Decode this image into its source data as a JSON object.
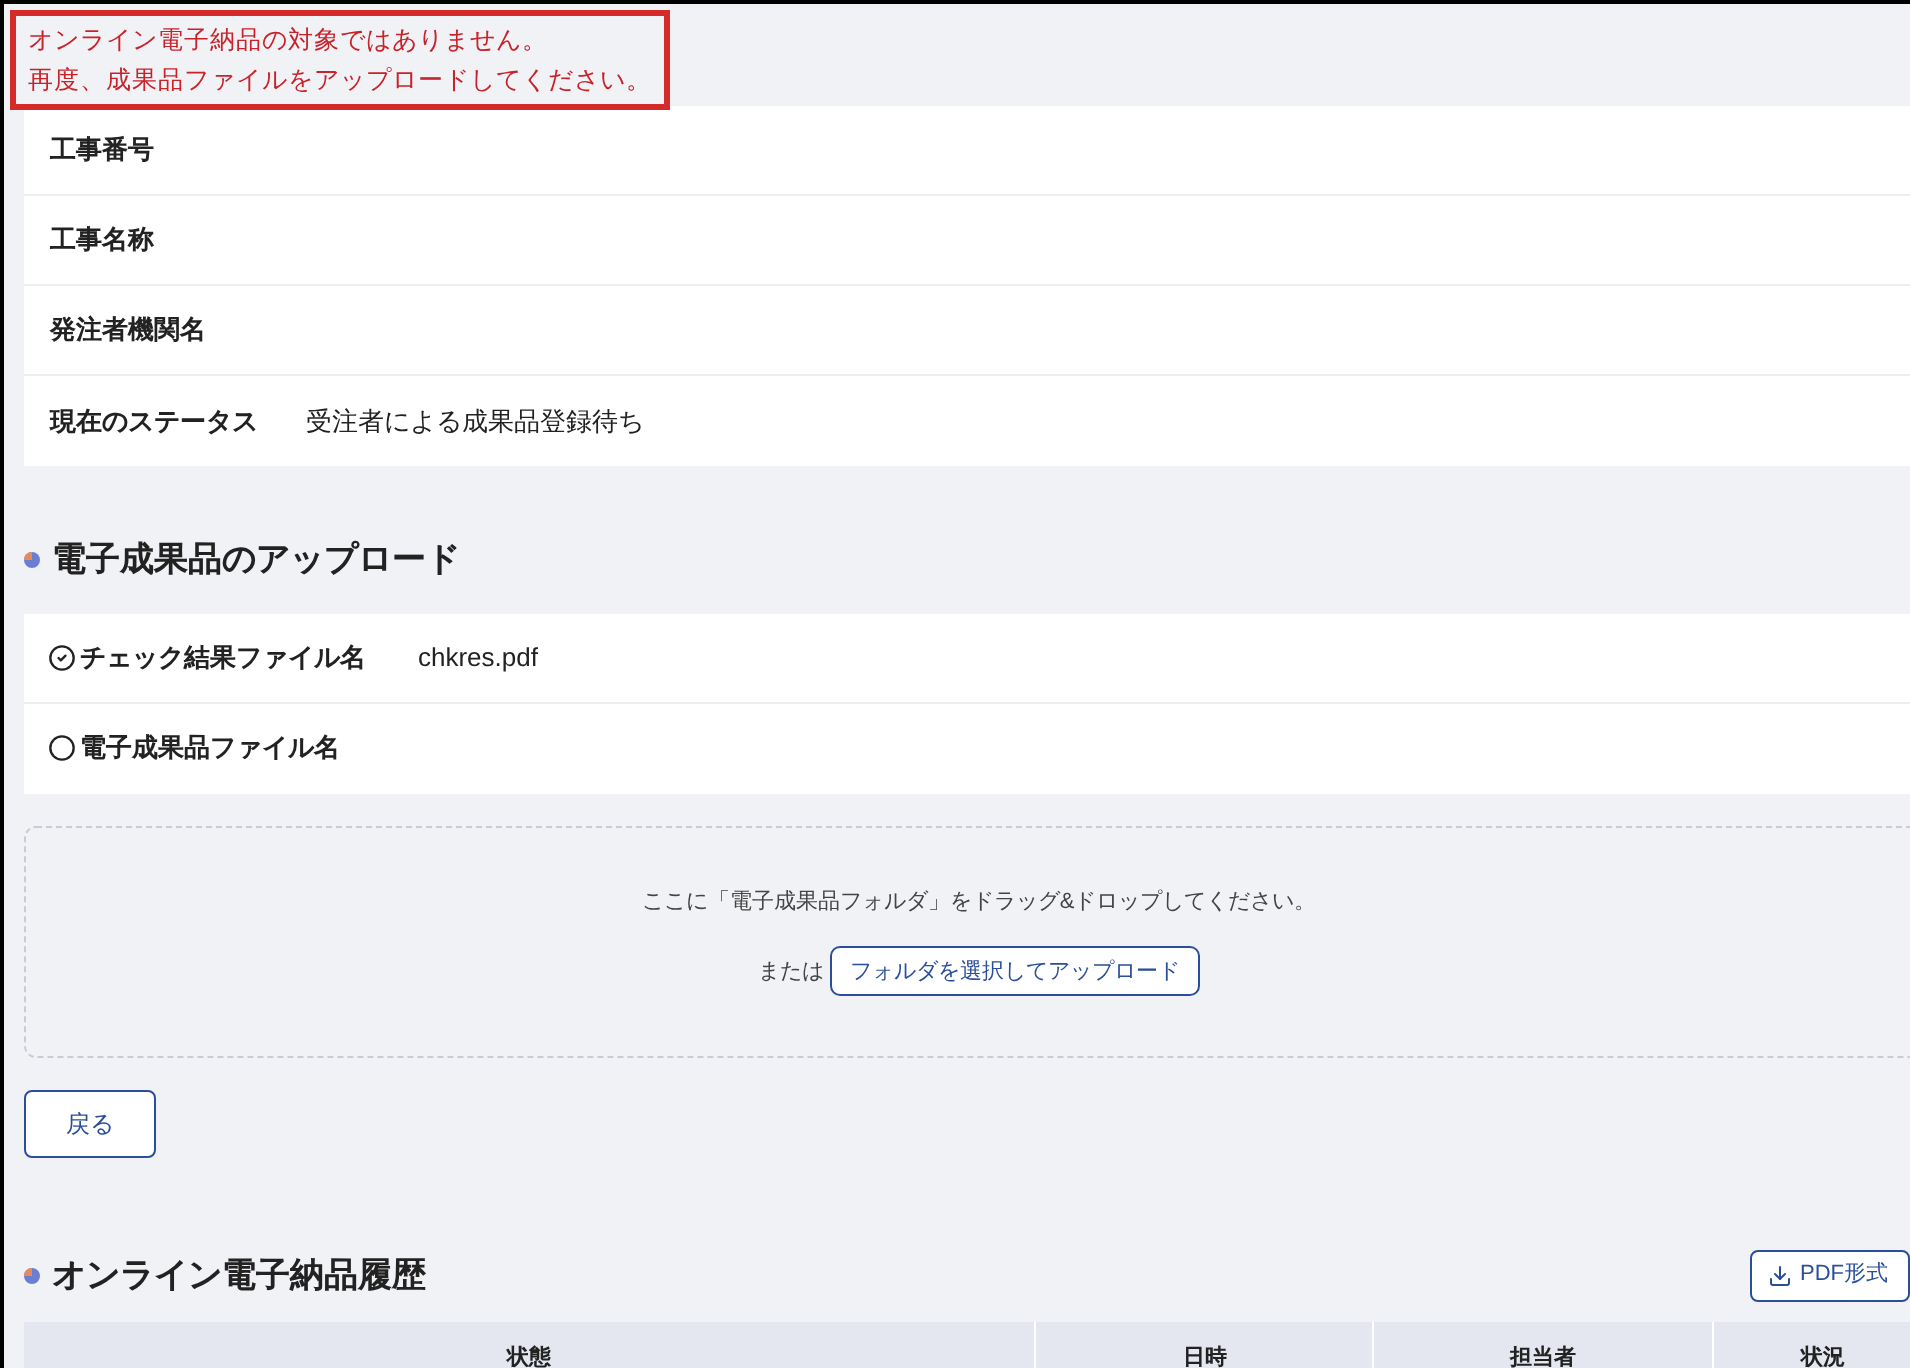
{
  "error_message": {
    "lines": [
      "オンライン電子納品の対象ではありません。",
      "再度、成果品ファイルをアップロードしてください。"
    ]
  },
  "info_rows": [
    {
      "label": "工事番号"
    },
    {
      "label": "工事名称"
    },
    {
      "label": "発注者機関名"
    },
    {
      "label": "現在のステータス",
      "value": "受注者による成果品登録待ち"
    }
  ],
  "upload_section": {
    "title": "電子成果品のアップロード",
    "files": [
      {
        "label": "チェック結果ファイル名",
        "done": true,
        "value": "chkres.pdf"
      },
      {
        "label": "電子成果品ファイル名",
        "done": false
      }
    ],
    "dropzone": {
      "instruction": "ここに「電子成果品フォルダ」をドラッグ&ドロップしてください。",
      "or_text": "または",
      "button": "フォルダを選択してアップロード"
    }
  },
  "back_button": "戻る",
  "history": {
    "title": "オンライン電子納品履歴",
    "pdf_button": "PDF形式",
    "columns": [
      "状態",
      "日時",
      "担当者",
      "状況"
    ]
  }
}
